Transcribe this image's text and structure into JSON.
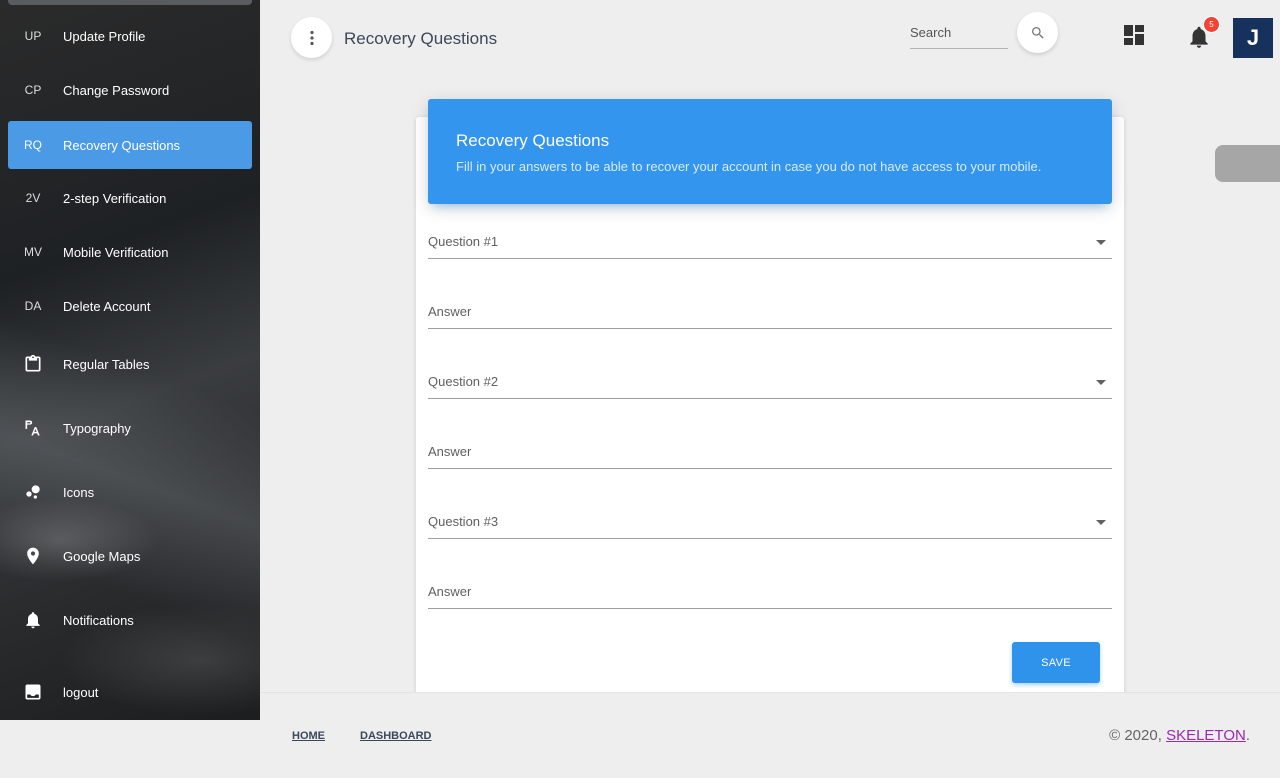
{
  "sidebar": {
    "items": [
      {
        "abbr": "UP",
        "label": "Update Profile"
      },
      {
        "abbr": "CP",
        "label": "Change Password"
      },
      {
        "abbr": "RQ",
        "label": "Recovery Questions"
      },
      {
        "abbr": "2V",
        "label": "2-step Verification"
      },
      {
        "abbr": "MV",
        "label": "Mobile Verification"
      },
      {
        "abbr": "DA",
        "label": "Delete Account"
      },
      {
        "icon": "clipboard-icon",
        "label": "Regular Tables"
      },
      {
        "icon": "typography-icon",
        "label": "Typography"
      },
      {
        "icon": "bubble-chart-icon",
        "label": "Icons"
      },
      {
        "icon": "location-pin-icon",
        "label": "Google Maps"
      },
      {
        "icon": "bell-icon",
        "label": "Notifications"
      },
      {
        "icon": "logout-icon",
        "label": "logout"
      }
    ],
    "active_index": 2
  },
  "header": {
    "title": "Recovery Questions",
    "search_placeholder": "Search",
    "notification_count": "5",
    "avatar_initial": "J"
  },
  "card": {
    "title": "Recovery Questions",
    "subtitle": "Fill in your answers to be able to recover your account in case you do not have access to your mobile.",
    "fields": [
      {
        "label": "Question #1",
        "type": "select"
      },
      {
        "label": "Answer",
        "type": "text"
      },
      {
        "label": "Question #2",
        "type": "select"
      },
      {
        "label": "Answer",
        "type": "text"
      },
      {
        "label": "Question #3",
        "type": "select"
      },
      {
        "label": "Answer",
        "type": "text"
      }
    ],
    "save_label": "SAVE"
  },
  "footer": {
    "links": [
      "HOME",
      "DASHBOARD"
    ],
    "copyright_prefix": "© 2020, ",
    "brand": "SKELETON",
    "copyright_suffix": "."
  },
  "colors": {
    "accent": "#3395ee",
    "badge": "#f44336",
    "avatar": "#16325c",
    "brand_link": "#9c27b0"
  }
}
